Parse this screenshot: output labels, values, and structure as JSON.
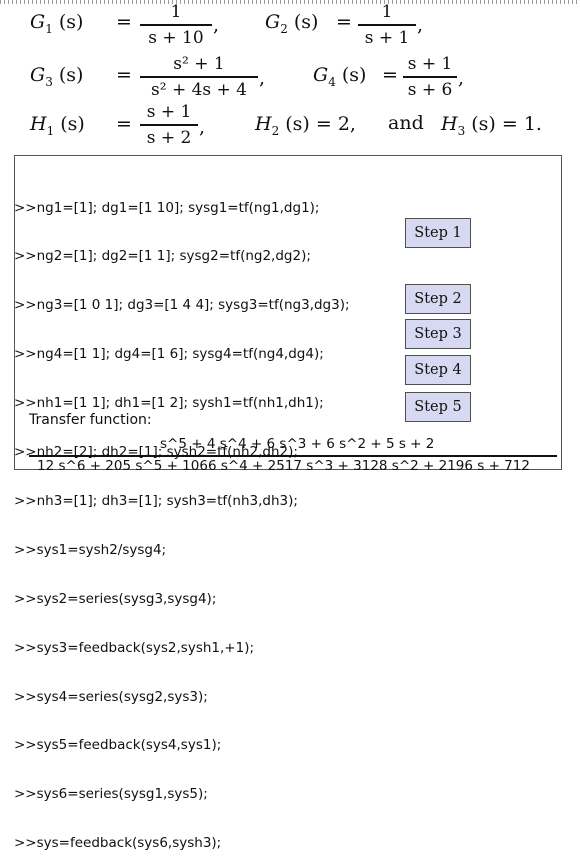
{
  "equations": {
    "row1": {
      "lhs1": "G",
      "sub1": "1",
      "arg1": "(s)",
      "eq1": "=",
      "num1": "1",
      "den1": "s + 10",
      "lhs2": "G",
      "sub2": "2",
      "arg2": "(s)",
      "eq2": "=",
      "num2": "1",
      "den2": "s + 1"
    },
    "row2": {
      "lhs1": "G",
      "sub1": "3",
      "arg1": "(s)",
      "eq1": "=",
      "num1": "s² + 1",
      "den1": "s² + 4s + 4",
      "lhs2": "G",
      "sub2": "4",
      "arg2": "(s)",
      "eq2": "=",
      "num2": "s + 1",
      "den2": "s + 6"
    },
    "row3": {
      "lhs1": "H",
      "sub1": "1",
      "arg1": "(s)",
      "eq1": "=",
      "num1": "s + 1",
      "den1": "s + 2",
      "h2": "H",
      "h2sub": "2",
      "h2arg": "(s) = 2,",
      "and": "and",
      "h3": "H",
      "h3sub": "3",
      "h3arg": "(s) = 1."
    },
    "comma": ",",
    "period": "."
  },
  "code": {
    "lines": [
      ">>ng1=[1]; dg1=[1 10]; sysg1=tf(ng1,dg1);",
      ">>ng2=[1]; dg2=[1 1]; sysg2=tf(ng2,dg2);",
      ">>ng3=[1 0 1]; dg3=[1 4 4]; sysg3=tf(ng3,dg3);",
      ">>ng4=[1 1]; dg4=[1 6]; sysg4=tf(ng4,dg4);",
      ">>nh1=[1 1]; dh1=[1 2]; sysh1=tf(nh1,dh1);",
      ">>nh2=[2]; dh2=[1]; sysh2=tf(nh2,dh2);",
      ">>nh3=[1]; dh3=[1]; sysh3=tf(nh3,dh3);",
      ">>sys1=sysh2/sysg4;",
      ">>sys2=series(sysg3,sysg4);",
      ">>sys3=feedback(sys2,sysh1,+1);",
      ">>sys4=series(sysg2,sys3);",
      ">>sys5=feedback(sys4,sys1);",
      ">>sys6=series(sysg1,sys5);",
      ">>sys=feedback(sys6,sysh3);"
    ],
    "transfer_label": "Transfer function:",
    "tf_numerator": "s^5 + 4 s^4 + 6 s^3 + 6 s^2 + 5 s + 2",
    "tf_denominator": "12 s^6 + 205 s^5 + 1066 s^4 + 2517 s^3 + 3128 s^2 + 2196 s + 712"
  },
  "steps": [
    "Step 1",
    "Step 2",
    "Step 3",
    "Step 4",
    "Step 5"
  ],
  "colors": {
    "step_fill": "#d7d9f2",
    "step_border": "#505050"
  }
}
